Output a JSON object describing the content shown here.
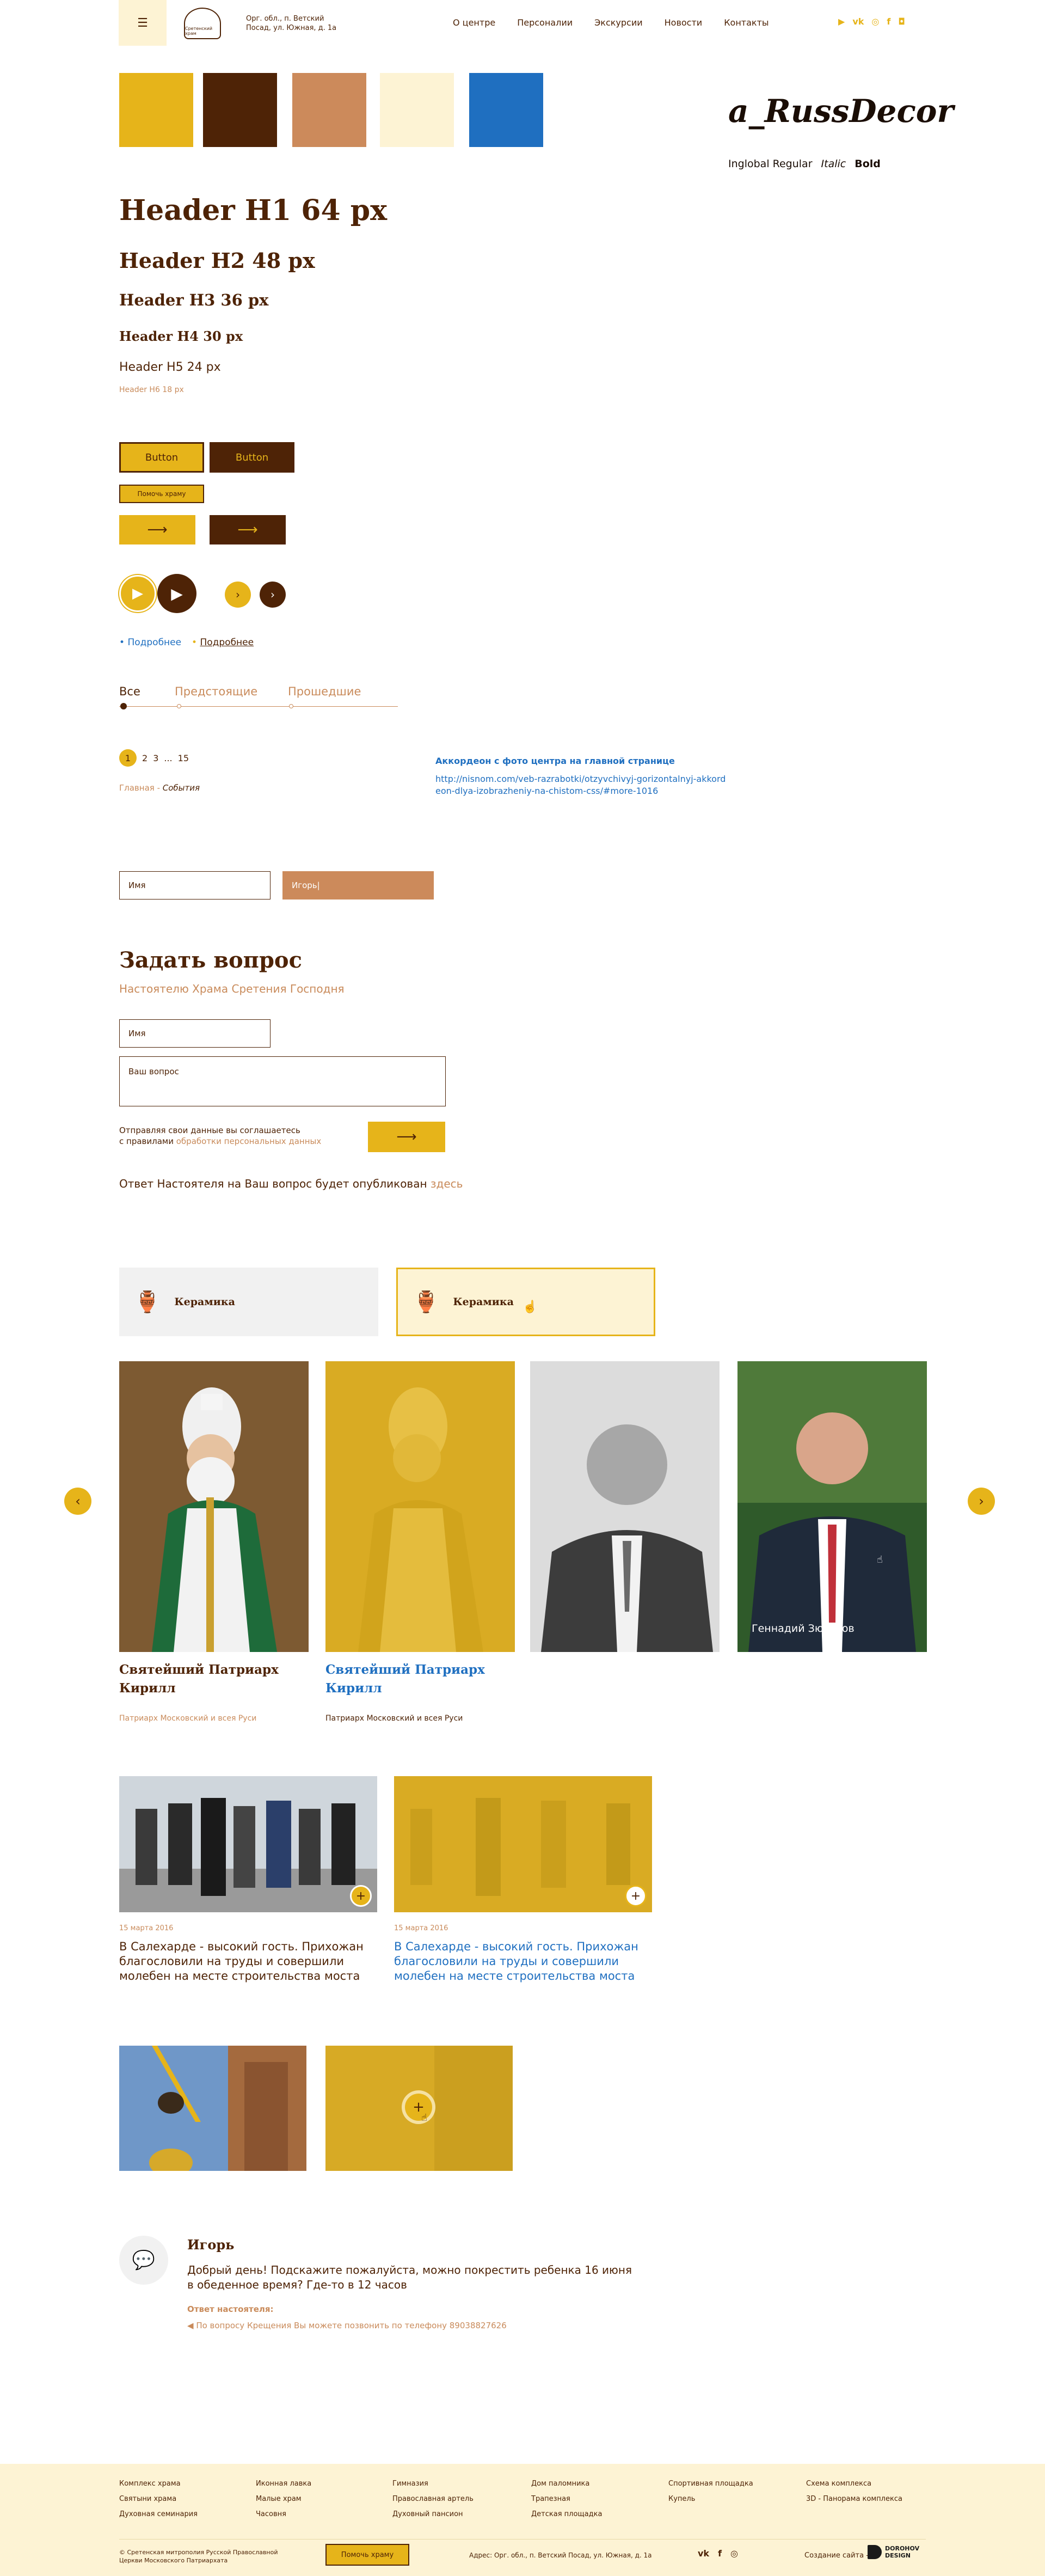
{
  "header": {
    "address": "Орг. обл., п. Ветский Посад, ул. Южная, д. 1а",
    "logo_text": "Сретенский храм",
    "nav": [
      "О центре",
      "Персоналии",
      "Экскурсии",
      "Новости",
      "Контакты"
    ],
    "social_icons": [
      "youtube-icon",
      "vk-icon",
      "instagram-icon",
      "facebook-icon",
      "ok-icon"
    ]
  },
  "palette": [
    "#e6b41a",
    "#4e2306",
    "#cc8a5b",
    "#fdf3d4",
    "#1f6fc0"
  ],
  "font": {
    "name": "a_RussDecor",
    "styles": [
      "Inglobal Regular",
      "Italic",
      "Bold"
    ]
  },
  "headings": {
    "h1": "Header H1 64 px",
    "h2": "Header H2 48 px",
    "h3": "Header H3 36 px",
    "h4": "Header H4 30 px",
    "h5": "Header H5 24 px",
    "h6": "Header H6 18 px"
  },
  "buttons": {
    "btn1": "Button",
    "btn2": "Button",
    "small": "Помочь храму"
  },
  "links": {
    "more1": "Подробнее",
    "more2": "Подробнее"
  },
  "tabs": [
    "Все",
    "Предстоящие",
    "Прошедшие"
  ],
  "pagination": [
    "1",
    "2",
    "3",
    "...",
    "15"
  ],
  "breadcrumb": {
    "home": "Главная",
    "sep": "-",
    "current": "События"
  },
  "accordion_note": {
    "title": "Аккордеон с фото центра на главной странице",
    "link": "http://nisnom.com/veb-razrabotki/otzyvchivyj-gorizontalnyj-akkordeon-dlya-izobrazheniy-na-chistom-css/#more-1016"
  },
  "fields": {
    "name_placeholder": "Имя",
    "name_value": "Игорь|"
  },
  "question": {
    "title": "Задать вопрос",
    "subtitle": "Настоятелю Храма Сретения Господня",
    "name_placeholder": "Имя",
    "question_placeholder": "Ваш вопрос",
    "consent1": "Отправляя свои данные вы соглашаетесь",
    "consent2": "с правилами",
    "consent_link": "обработки персональных данных",
    "answer_note": "Ответ Настоятеля на Ваш вопрос будет опубликован",
    "answer_link": "здесь"
  },
  "categories": [
    "Керамика",
    "Керамика"
  ],
  "people": [
    {
      "name": "Святейший Патриарх Кирилл",
      "title": "Патриарх Московский и всея Руси"
    },
    {
      "name": "Святейший Патриарх Кирилл",
      "title": "Патриарх Московский и всея Руси"
    },
    {
      "name": "",
      "title": ""
    },
    {
      "name": "Геннадий Зюганов",
      "title": ""
    }
  ],
  "news": [
    {
      "date": "15 марта 2016",
      "text": "В Салехарде - высокий гость. Прихожан благословили на труды и совершили молебен на месте строительства моста"
    },
    {
      "date": "15 марта 2016",
      "text": "В Салехарде - высокий гость. Прихожан благословили на труды и совершили молебен на месте строительства моста"
    }
  ],
  "comment": {
    "author": "Игорь",
    "text": "Добрый день! Подскажите пожалуйста, можно покрестить ребенка 16 июня в обеденное время? Где-то в 12 часов",
    "answer_label": "Ответ настоятеля:",
    "answer": "По вопросу Крещения Вы можете позвонить по телефону 89038827626"
  },
  "footer": {
    "col1": [
      "Комплекс храма",
      "Святыни храма",
      "Духовная семинария"
    ],
    "col2": [
      "Иконная лавка",
      "Малые храм",
      "Часовня"
    ],
    "col3": [
      "Гимназия",
      "Православная артель",
      "Духовный пансион"
    ],
    "col4": [
      "Дом паломника",
      "Трапезная",
      "Детская площадка"
    ],
    "col5": [
      "Спортивная площадка",
      "Купель"
    ],
    "col6": [
      "Схема комплекса",
      "3D - Панорама комплекса"
    ],
    "copyright": "© Сретенская митрополия Русской Православной Церкви Московского Патриархата",
    "help_button": "Помочь храму",
    "address": "Адрес: Орг. обл., п. Ветский Посад, ул. Южная, д. 1а",
    "created_by": "Создание сайта -",
    "studio": "DOROHOV DESIGN"
  }
}
